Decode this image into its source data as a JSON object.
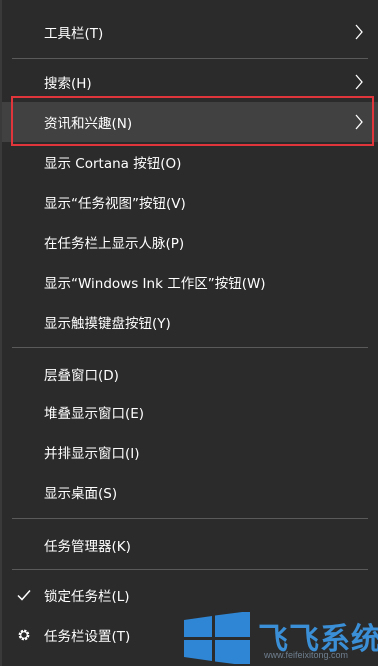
{
  "menu": {
    "items": [
      {
        "label": "工具栏(T)",
        "has_submenu": true
      },
      {
        "label": "搜索(H)",
        "has_submenu": true
      },
      {
        "label": "资讯和兴趣(N)",
        "has_submenu": true,
        "highlighted": true
      },
      {
        "label": "显示 Cortana 按钮(O)"
      },
      {
        "label": "显示“任务视图”按钮(V)"
      },
      {
        "label": "在任务栏上显示人脉(P)"
      },
      {
        "label": "显示“Windows Ink 工作区”按钮(W)"
      },
      {
        "label": "显示触摸键盘按钮(Y)"
      },
      {
        "label": "层叠窗口(D)"
      },
      {
        "label": "堆叠显示窗口(E)"
      },
      {
        "label": "并排显示窗口(I)"
      },
      {
        "label": "显示桌面(S)"
      },
      {
        "label": "任务管理器(K)"
      },
      {
        "label": "锁定任务栏(L)",
        "checked": true,
        "icon": "check-icon"
      },
      {
        "label": "任务栏设置(T)",
        "icon": "gear-icon"
      }
    ]
  },
  "watermark": {
    "logo": "飞飞系统",
    "url": "www.feifeixitong.com"
  },
  "colors": {
    "menu_bg": "#2b2b2b",
    "hover_bg": "#414141",
    "separator": "#5a5a5a",
    "highlight_border": "#e0353b",
    "text": "#ffffff"
  }
}
